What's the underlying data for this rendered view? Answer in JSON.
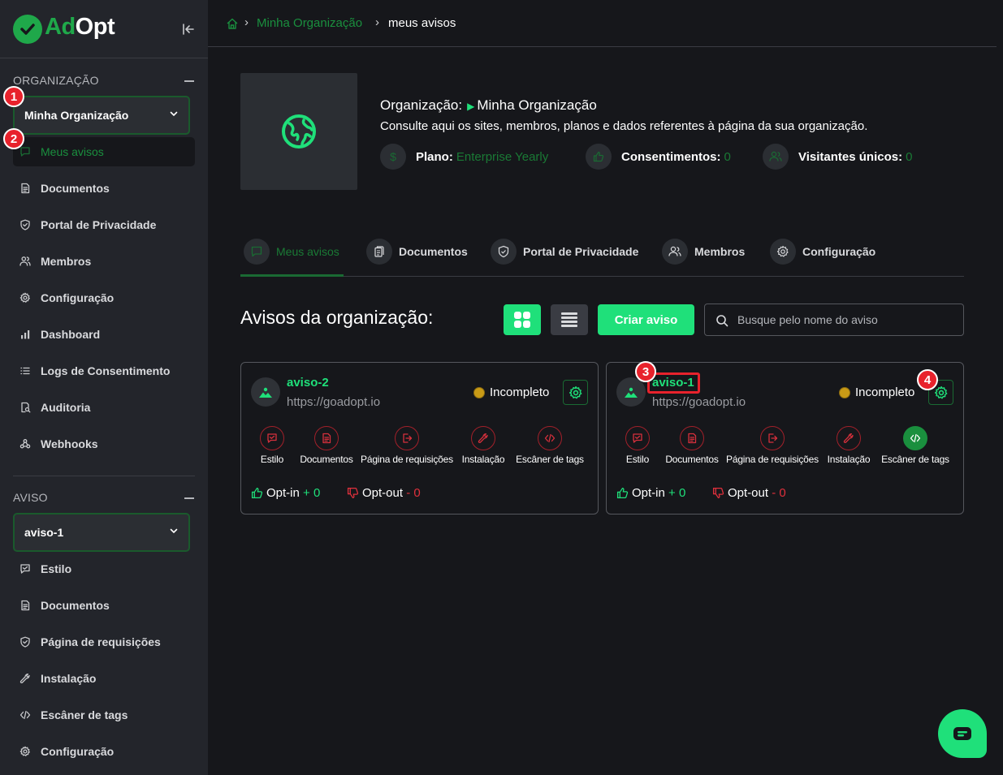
{
  "sidebar": {
    "logo_ad": "Ad",
    "logo_opt": "Opt",
    "org_section_label": "ORGANIZAÇÃO",
    "org_selected": "Minha Organização",
    "org_items": [
      {
        "label": "Meus avisos",
        "icon": "chat-square-icon",
        "active": true
      },
      {
        "label": "Documentos",
        "icon": "document-icon"
      },
      {
        "label": "Portal de Privacidade",
        "icon": "shield-icon"
      },
      {
        "label": "Membros",
        "icon": "users-icon"
      },
      {
        "label": "Configuração",
        "icon": "gear-icon"
      },
      {
        "label": "Dashboard",
        "icon": "bar-chart-icon"
      },
      {
        "label": "Logs de Consentimento",
        "icon": "list-icon"
      },
      {
        "label": "Auditoria",
        "icon": "audit-icon"
      },
      {
        "label": "Webhooks",
        "icon": "webhook-icon"
      }
    ],
    "aviso_section_label": "AVISO",
    "aviso_selected": "aviso-1",
    "aviso_items": [
      {
        "label": "Estilo",
        "icon": "style-icon"
      },
      {
        "label": "Documentos",
        "icon": "document-icon"
      },
      {
        "label": "Página de requisições",
        "icon": "shield-icon"
      },
      {
        "label": "Instalação",
        "icon": "wrench-icon"
      },
      {
        "label": "Escâner de tags",
        "icon": "code-icon"
      },
      {
        "label": "Configuração",
        "icon": "gear-icon"
      }
    ]
  },
  "breadcrumb": {
    "org": "Minha Organização",
    "current": "meus avisos"
  },
  "org_header": {
    "title_prefix": "Organização:",
    "title_name": "Minha Organização",
    "description": "Consulte aqui os sites, membros, planos e dados referentes à página da sua organização.",
    "plan_label": "Plano:",
    "plan_value": "Enterprise Yearly",
    "consent_label": "Consentimentos:",
    "consent_value": "0",
    "visitors_label": "Visitantes únicos:",
    "visitors_value": "0"
  },
  "tabs": [
    {
      "label": "Meus avisos",
      "icon": "chat-square-icon",
      "active": true
    },
    {
      "label": "Documentos",
      "icon": "clipboard-icon"
    },
    {
      "label": "Portal de Privacidade",
      "icon": "shield-icon"
    },
    {
      "label": "Membros",
      "icon": "users-icon"
    },
    {
      "label": "Configuração",
      "icon": "gear-icon"
    }
  ],
  "toolbar": {
    "title": "Avisos da organização:",
    "create_label": "Criar aviso",
    "search_placeholder": "Busque pelo nome do aviso"
  },
  "cards": [
    {
      "name": "aviso-2",
      "url": "https://goadopt.io",
      "status": "Incompleto",
      "actions": [
        "Estilo",
        "Documentos",
        "Página de requisições",
        "Instalação",
        "Escâner de tags"
      ],
      "optin_label": "Opt-in",
      "optin_value": "+ 0",
      "optout_label": "Opt-out",
      "optout_value": "- 0"
    },
    {
      "name": "aviso-1",
      "url": "https://goadopt.io",
      "status": "Incompleto",
      "actions": [
        "Estilo",
        "Documentos",
        "Página de requisições",
        "Instalação",
        "Escâner de tags"
      ],
      "optin_label": "Opt-in",
      "optin_value": "+ 0",
      "optout_label": "Opt-out",
      "optout_value": "- 0"
    }
  ],
  "annotations": [
    "1",
    "2",
    "3",
    "4"
  ],
  "colors": {
    "accent": "#1fe07a",
    "accent_dark": "#1a8f3e",
    "danger": "#e0303c",
    "warning": "#c89a16",
    "sidebar_bg": "#23252b",
    "main_bg": "#16171b"
  }
}
